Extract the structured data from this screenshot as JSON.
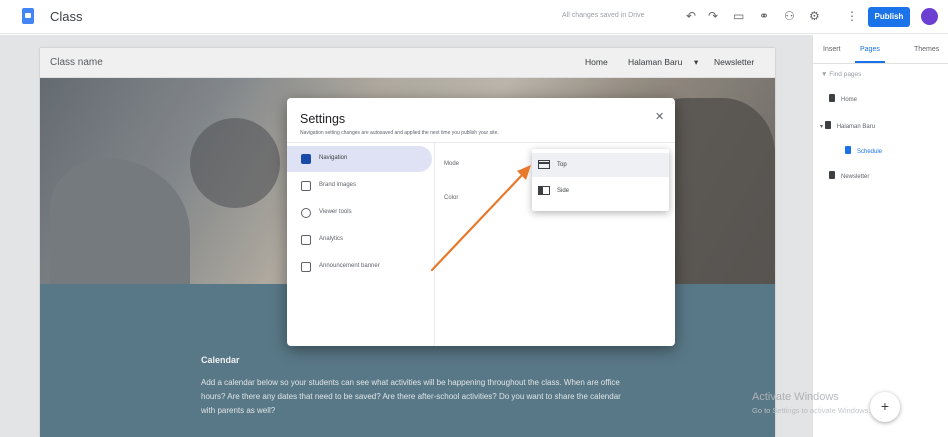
{
  "app": {
    "title": "Class",
    "save_status": "All changes saved in Drive",
    "publish_label": "Publish",
    "avatar_initial": "",
    "toolbar_icons": [
      "undo-icon",
      "redo-icon",
      "preview-icon",
      "link-icon",
      "share-icon",
      "gear-icon",
      "more-icon"
    ]
  },
  "site": {
    "name": "Class name",
    "nav": [
      "Home",
      "Halaman Baru",
      "Newsletter"
    ],
    "calendar_title": "Calendar",
    "calendar_text": "Add a calendar below so your students can see what activities will be happening throughout the class. When are office hours? Are there any dates that need to be saved? Are there after-school activities? Do you want to share the calendar with parents as well?"
  },
  "right_panel": {
    "tabs": [
      "Insert",
      "Pages",
      "Themes"
    ],
    "active_tab": "Pages",
    "filter_placeholder": "Find pages",
    "pages": [
      {
        "label": "Home",
        "active": false
      },
      {
        "label": "Halaman Baru",
        "active": false
      },
      {
        "label": "Schedule",
        "active": true
      },
      {
        "label": "Newsletter",
        "active": false
      }
    ]
  },
  "watermark": {
    "line1": "Activate Windows",
    "line2": "Go to Settings to activate Windows."
  },
  "settings": {
    "title": "Settings",
    "subtitle": "Navigation setting changes are autosaved and applied the next time you publish your site.",
    "menu": [
      {
        "label": "Navigation",
        "icon": "navigation-icon",
        "active": true
      },
      {
        "label": "Brand images",
        "icon": "image-icon",
        "active": false
      },
      {
        "label": "Viewer tools",
        "icon": "info-icon",
        "active": false
      },
      {
        "label": "Analytics",
        "icon": "analytics-icon",
        "active": false
      },
      {
        "label": "Announcement banner",
        "icon": "banner-icon",
        "active": false
      }
    ],
    "mode_label": "Mode",
    "color_label": "Color",
    "mode_options": [
      {
        "label": "Top",
        "selected": true
      },
      {
        "label": "Side",
        "selected": false
      }
    ]
  },
  "annotation": {
    "arrow_color": "#e8782a"
  }
}
